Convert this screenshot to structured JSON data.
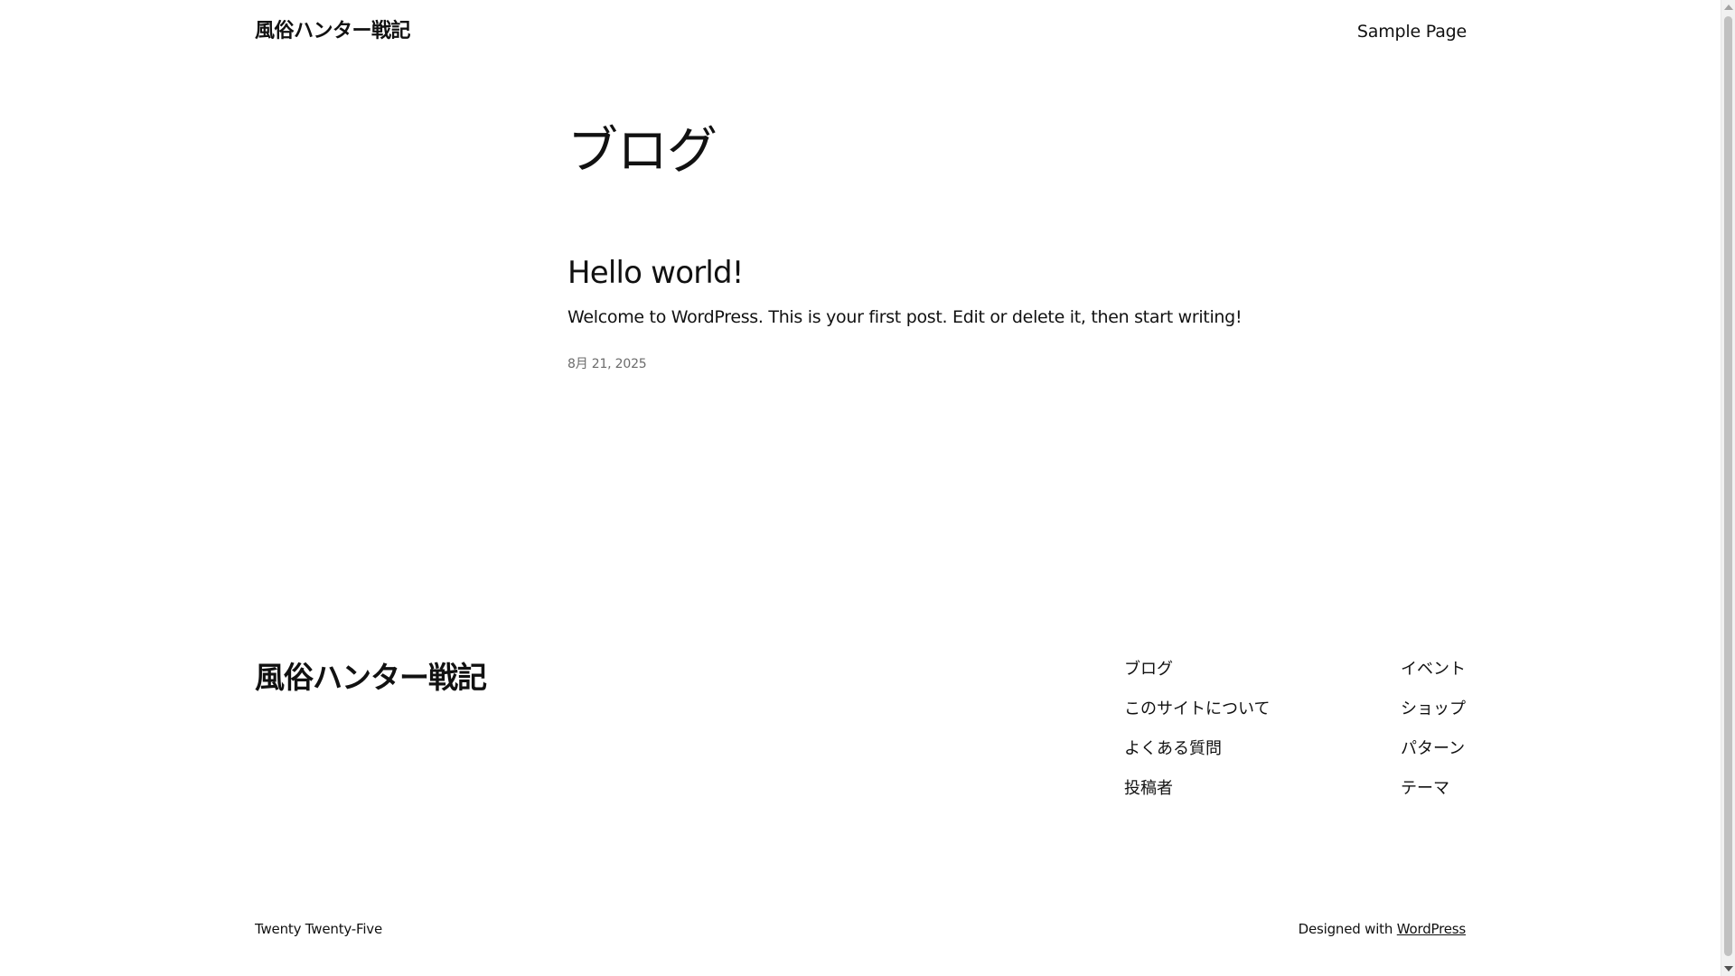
{
  "header": {
    "site_title": "風俗ハンター戦記",
    "nav": [
      "Sample Page"
    ]
  },
  "main": {
    "page_title": "ブログ",
    "post": {
      "title": "Hello world!",
      "excerpt": "Welcome to WordPress. This is your first post. Edit or delete it, then start writing!",
      "date": "8月 21, 2025"
    }
  },
  "footer": {
    "site_title": "風俗ハンター戦記",
    "col1": [
      "ブログ",
      "このサイトについて",
      "よくある質問",
      "投稿者"
    ],
    "col2": [
      "イベント",
      "ショップ",
      "パターン",
      "テーマ"
    ],
    "theme_name": "Twenty Twenty-Five",
    "designed_with": "Designed with",
    "wordpress_link": "WordPress"
  }
}
